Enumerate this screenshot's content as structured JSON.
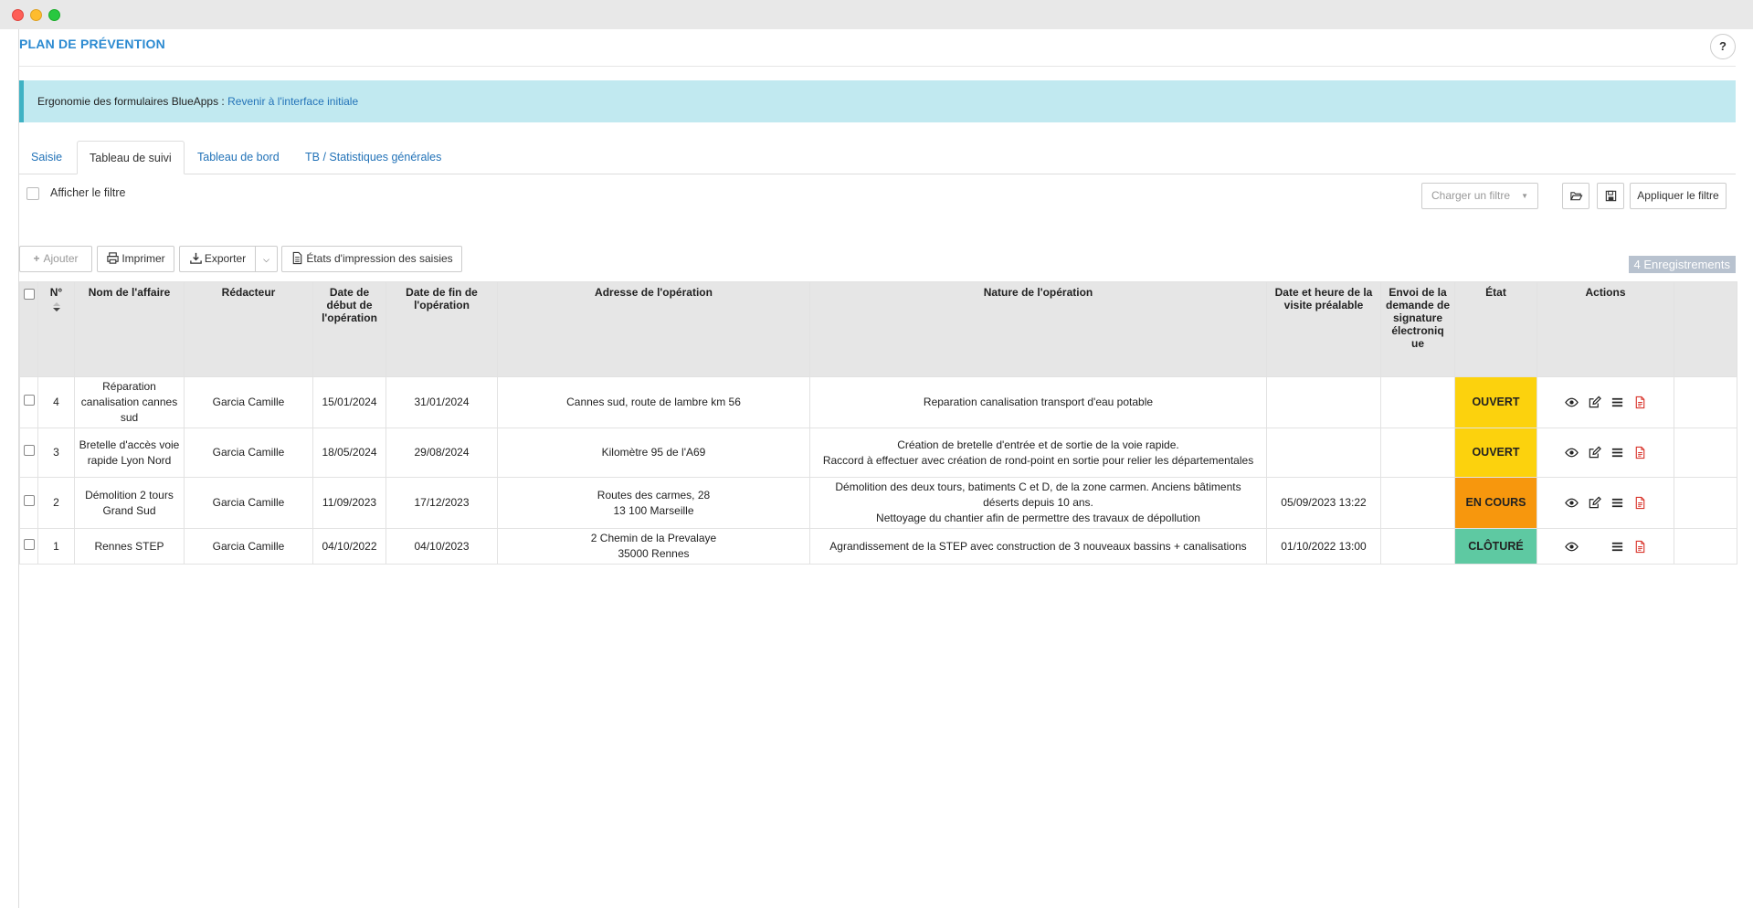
{
  "page": {
    "title": "PLAN DE PRÉVENTION",
    "help": "?"
  },
  "banner": {
    "text": "Ergonomie des formulaires BlueApps : ",
    "link": "Revenir à l'interface initiale"
  },
  "tabs": [
    {
      "label": "Saisie"
    },
    {
      "label": "Tableau de suivi"
    },
    {
      "label": "Tableau de bord"
    },
    {
      "label": "TB / Statistiques générales"
    }
  ],
  "filter": {
    "show_label": "Afficher le filtre",
    "load_placeholder": "Charger un filtre",
    "apply_label": "Appliquer le filtre"
  },
  "toolbar": {
    "add": "Ajouter",
    "print": "Imprimer",
    "export": "Exporter",
    "print_states": "États d'impression des saisies"
  },
  "record_count": "4 Enregistrements",
  "table": {
    "headers": {
      "num": "N°",
      "name": "Nom de l'affaire",
      "author": "Rédacteur",
      "start": "Date de début de l'opération",
      "end": "Date de fin de l'opération",
      "address": "Adresse de l'opération",
      "nature": "Nature de l'opération",
      "visit": "Date et heure de la visite préalable",
      "signature": "Envoi de la demande de signature électroniq ue",
      "state": "État",
      "actions": "Actions"
    },
    "rows": [
      {
        "num": "4",
        "name": "Réparation canalisation cannes sud",
        "author": "Garcia Camille",
        "start": "15/01/2024",
        "end": "31/01/2024",
        "address": [
          "Cannes sud, route de lambre km 56"
        ],
        "nature": [
          "Reparation canalisation transport d'eau potable"
        ],
        "visit": "",
        "signature": "",
        "state": "OUVERT",
        "state_color": "#fcd20d",
        "actions": [
          "eye-icon",
          "edit-icon",
          "list-icon",
          "pdf-icon"
        ]
      },
      {
        "num": "3",
        "name": "Bretelle d'accès voie rapide Lyon Nord",
        "author": "Garcia Camille",
        "start": "18/05/2024",
        "end": "29/08/2024",
        "address": [
          "Kilomètre 95 de l'A69"
        ],
        "nature": [
          "Création de bretelle d'entrée et de sortie de la voie rapide.",
          "Raccord à effectuer avec création de rond-point en sortie pour relier les départementales"
        ],
        "visit": "",
        "signature": "",
        "state": "OUVERT",
        "state_color": "#fcd20d",
        "actions": [
          "eye-icon",
          "edit-icon",
          "list-icon",
          "pdf-icon"
        ]
      },
      {
        "num": "2",
        "name": "Démolition 2 tours Grand Sud",
        "author": "Garcia Camille",
        "start": "11/09/2023",
        "end": "17/12/2023",
        "address": [
          "Routes des carmes, 28",
          "13 100 Marseille"
        ],
        "nature": [
          "Démolition des deux tours, batiments C et D, de la zone carmen. Anciens bâtiments déserts depuis 10 ans.",
          "Nettoyage du chantier afin de permettre des travaux de dépollution"
        ],
        "visit": "05/09/2023 13:22",
        "signature": "",
        "state": "EN COURS",
        "state_color": "#f7970d",
        "actions": [
          "eye-icon",
          "edit-icon",
          "list-icon",
          "pdf-icon"
        ]
      },
      {
        "num": "1",
        "name": "Rennes STEP",
        "author": "Garcia Camille",
        "start": "04/10/2022",
        "end": "04/10/2023",
        "address": [
          "2 Chemin de la Prevalaye",
          "35000 Rennes"
        ],
        "nature": [
          "Agrandissement de la STEP avec construction de 3 nouveaux bassins + canalisations"
        ],
        "visit": "01/10/2022 13:00",
        "signature": "",
        "state": "CLÔTURÉ",
        "state_color": "#5ec9a2",
        "actions": [
          "eye-icon",
          "list-icon",
          "pdf-icon"
        ]
      }
    ]
  }
}
